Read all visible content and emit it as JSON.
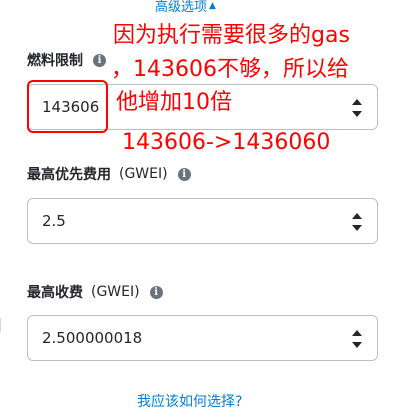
{
  "advanced_toggle": {
    "label": "高级选项",
    "caret": "▲"
  },
  "gas_limit": {
    "label": "燃料限制",
    "value": "143606"
  },
  "max_priority_fee": {
    "label": "最高优先费用",
    "unit": "(GWEI)",
    "value": "2.5"
  },
  "max_fee": {
    "label": "最高收费",
    "unit": "(GWEI)",
    "value": "2.500000018"
  },
  "help_link": "我应该如何选择?",
  "info_icon_glyph": "i",
  "annotation": {
    "line1": "因为执行需要很多的gas",
    "line2": "，143606不够，所以给",
    "line3": "他增加10倍",
    "line4": "143606->1436060"
  },
  "colors": {
    "link": "#037dd6",
    "annotation": "#ff0000",
    "border": "#bbc0c5"
  },
  "icons": [
    "info-icon",
    "caret-up-icon",
    "number-spinner-icon"
  ]
}
